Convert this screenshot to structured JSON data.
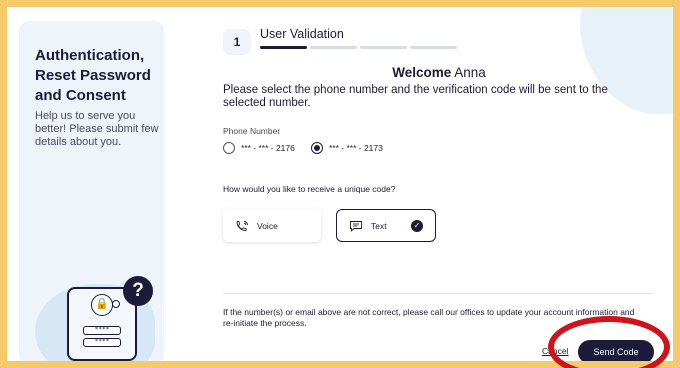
{
  "sidebar": {
    "title": "Authentication, Reset Password and Consent",
    "text": "Help us to serve you better! Please submit few details about you."
  },
  "stepper": {
    "step_number": "1",
    "step_title": "User Validation",
    "segments": 4,
    "active_segment": 1
  },
  "welcome": {
    "greeting": "Welcome",
    "name": "Anna"
  },
  "instructions": "Please select the phone number and the verification code will be sent to the selected number.",
  "phone": {
    "label": "Phone Number",
    "options": [
      {
        "value": "*** - *** - 2176",
        "selected": false
      },
      {
        "value": "*** - *** - 2173",
        "selected": true
      }
    ]
  },
  "receive": {
    "question": "How would you like to receive a unique code?",
    "options": [
      {
        "label": "Voice",
        "icon": "phone-icon",
        "selected": false
      },
      {
        "label": "Text",
        "icon": "message-icon",
        "selected": true
      }
    ]
  },
  "note": "If the number(s) or email above are not correct, please call our offices to update your account information and re-initiate the process.",
  "actions": {
    "cancel_label": "Cancel",
    "send_label": "Send Code"
  },
  "colors": {
    "primary": "#1c1c3a",
    "highlight_ring": "#d0121b",
    "frame_border": "#f6c96a"
  }
}
